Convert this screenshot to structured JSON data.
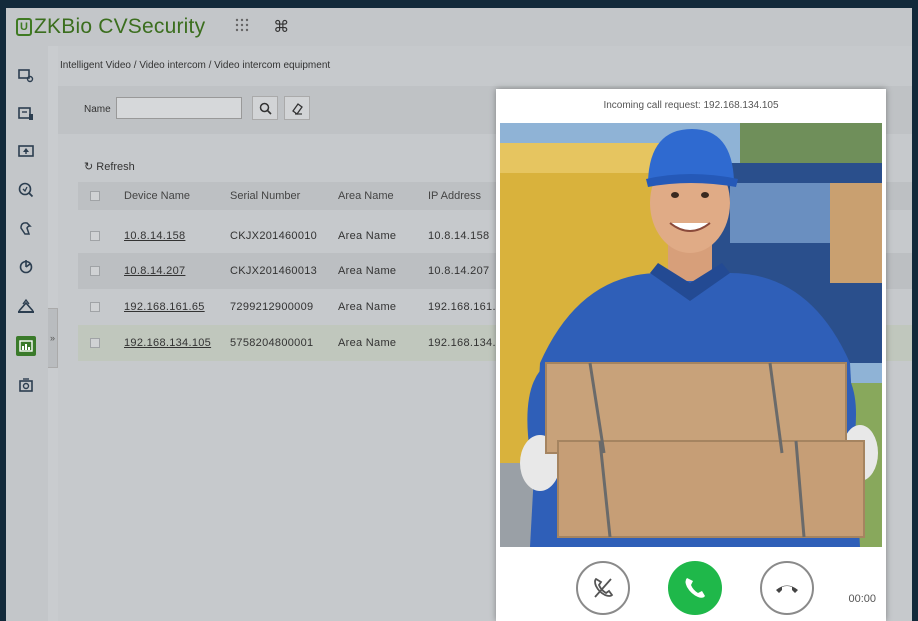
{
  "header": {
    "logo_badge": "U",
    "logo_zk": "ZK",
    "logo_bio": "Bio",
    "logo_rest": " CVSecurity",
    "apps_icon": "grid-icon",
    "command_icon": "command-icon"
  },
  "sidebar": {
    "items": [
      {
        "icon": "personnel-icon"
      },
      {
        "icon": "access-icon"
      },
      {
        "icon": "attendance-icon"
      },
      {
        "icon": "search-face-icon"
      },
      {
        "icon": "visitor-icon"
      },
      {
        "icon": "parking-icon"
      },
      {
        "icon": "elevator-icon"
      },
      {
        "icon": "video-intercom-icon"
      },
      {
        "icon": "camera-icon"
      }
    ]
  },
  "breadcrumb": "Intelligent Video / Video intercom / Video intercom equipment",
  "filter": {
    "name_label": "Name",
    "name_value": ""
  },
  "toolbar": {
    "refresh_label": "Refresh"
  },
  "table": {
    "columns": [
      "Device Name",
      "Serial Number",
      "Area Name",
      "IP Address"
    ],
    "rows": [
      {
        "device_name": "10.8.14.158",
        "serial": "CKJX201460010",
        "area": "Area Name",
        "ip": "10.8.14.158"
      },
      {
        "device_name": "10.8.14.207",
        "serial": "CKJX201460013",
        "area": "Area Name",
        "ip": "10.8.14.207"
      },
      {
        "device_name": "192.168.161.65",
        "serial": "7299212900009",
        "area": "Area Name",
        "ip": "192.168.161."
      },
      {
        "device_name": "192.168.134.105",
        "serial": "5758204800001",
        "area": "Area Name",
        "ip": "192.168.134."
      }
    ]
  },
  "call_popup": {
    "title": "Incoming call request: 192.168.134.105",
    "timer": "00:00",
    "answer_color": "#1fb84a"
  }
}
